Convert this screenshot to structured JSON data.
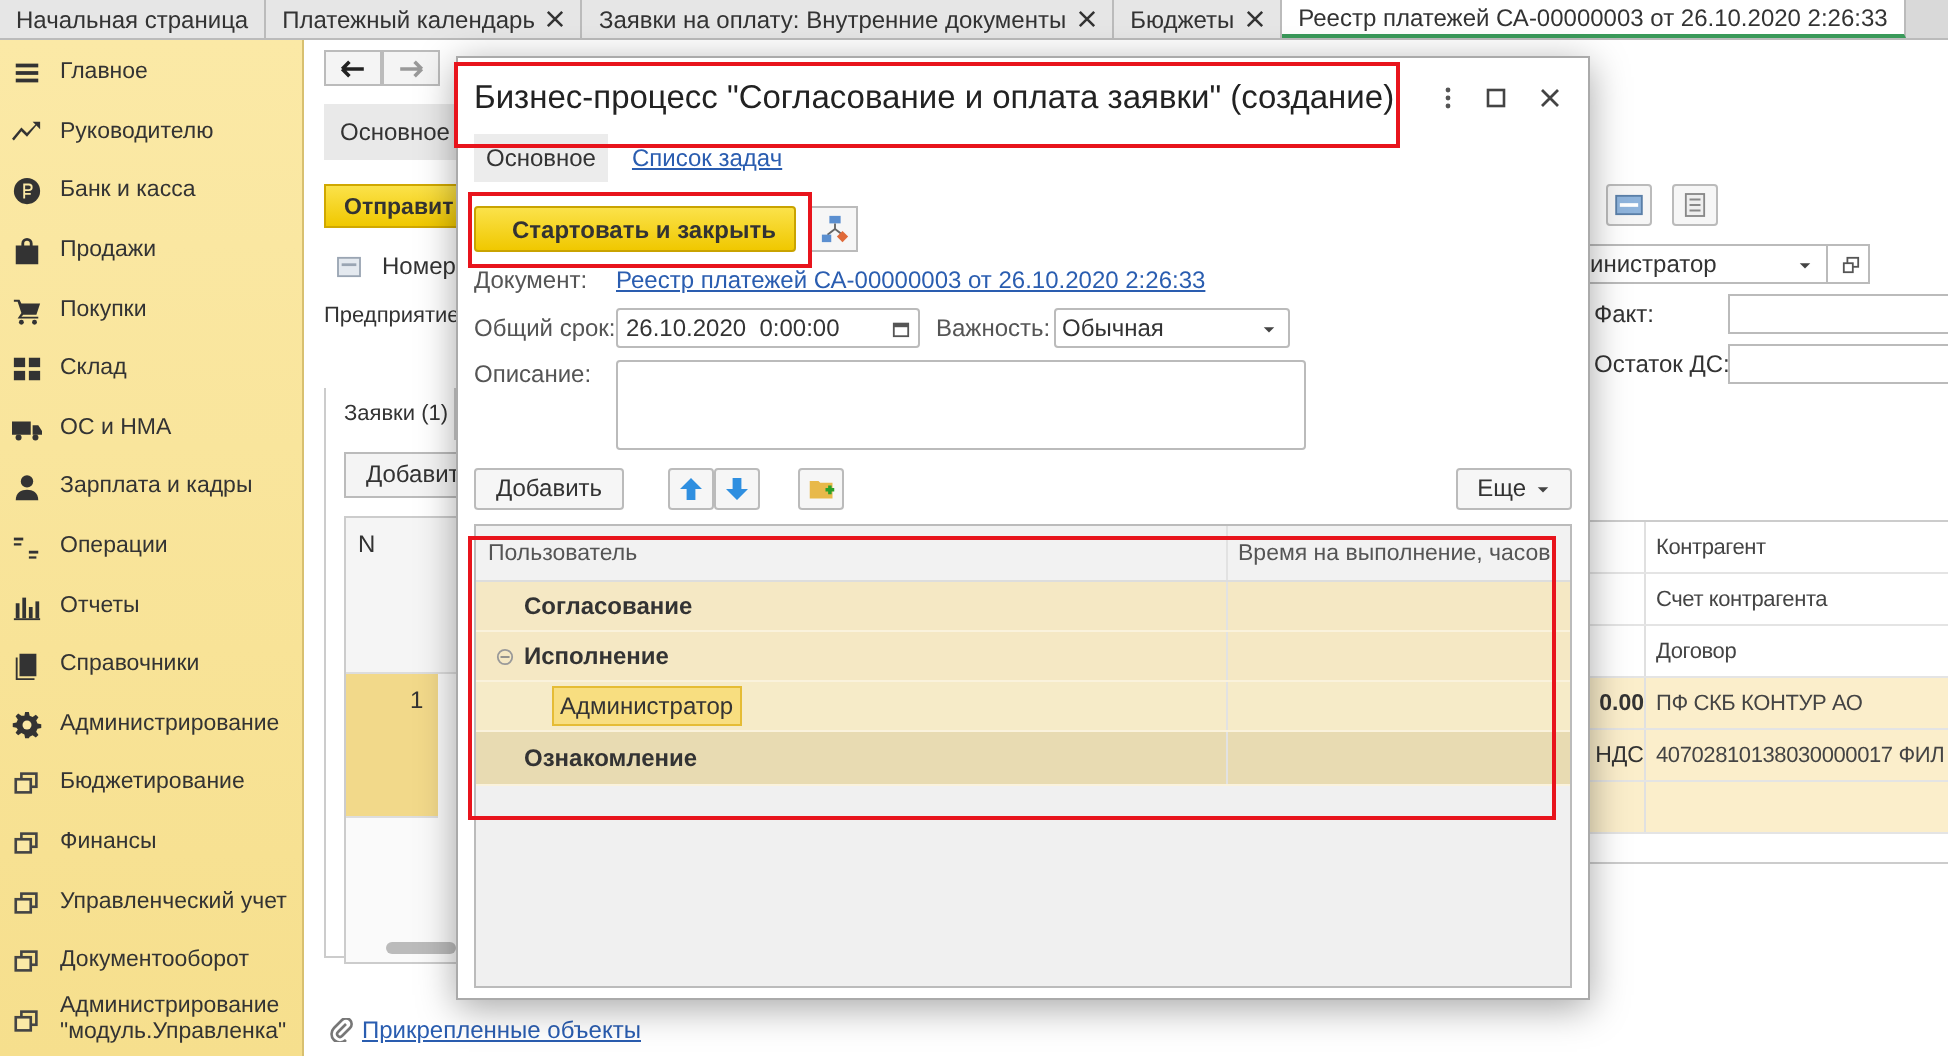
{
  "tabs": [
    {
      "label": "Начальная страница",
      "closable": false,
      "selected": false
    },
    {
      "label": "Платежный календарь",
      "closable": true,
      "selected": false
    },
    {
      "label": "Заявки на оплату: Внутренние документы",
      "closable": true,
      "selected": false
    },
    {
      "label": "Бюджеты",
      "closable": true,
      "selected": false
    },
    {
      "label": "Реестр платежей СА-00000003 от 26.10.2020 2:26:33",
      "closable": false,
      "selected": true
    }
  ],
  "sidebar": {
    "items": [
      {
        "label": "Главное"
      },
      {
        "label": "Руководителю"
      },
      {
        "label": "Банк и касса"
      },
      {
        "label": "Продажи"
      },
      {
        "label": "Покупки"
      },
      {
        "label": "Склад"
      },
      {
        "label": "ОС и НМА"
      },
      {
        "label": "Зарплата и кадры"
      },
      {
        "label": "Операции"
      },
      {
        "label": "Отчеты"
      },
      {
        "label": "Справочники"
      },
      {
        "label": "Администрирование"
      },
      {
        "label": "Бюджетирование"
      },
      {
        "label": "Финансы"
      },
      {
        "label": "Управленческий учет"
      },
      {
        "label": "Документооборот"
      },
      {
        "label": "Администрирование \"модуль.Управленка\""
      }
    ]
  },
  "document": {
    "tabs": [
      {
        "label": "Основное",
        "selected": true
      }
    ],
    "send_button": "Отправит",
    "number_label": "Номер",
    "org_label": "Предприятие",
    "section_tabs": [
      {
        "label": "Заявки (1)",
        "selected": true
      }
    ],
    "add_button": "Добавит",
    "table": {
      "columns": [
        "N"
      ],
      "rows": [
        {
          "n": "1",
          "selected": true
        }
      ]
    },
    "author_value": "инистратор",
    "fact_label": "Факт:",
    "balance_label": "Остаток ДС:",
    "right_table": {
      "columns": [
        "Контрагент",
        "Счет контрагента",
        "Договор"
      ],
      "rows": [
        {
          "amount": "0.00",
          "vat": "НДС",
          "counterparty": "ПФ СКБ КОНТУР АО",
          "account": "40702810138030000017 ФИЛ",
          "selected": true
        }
      ]
    },
    "attachments_link": "Прикрепленные объекты"
  },
  "dialog": {
    "title": "Бизнес-процесс \"Согласование и оплата заявки\" (создание)",
    "tabs": [
      {
        "label": "Основное",
        "selected": true
      },
      {
        "label": "Список задач",
        "selected": false
      }
    ],
    "start_button": "Стартовать и закрыть",
    "document_label": "Документ:",
    "document_link": "Реестр платежей СА-00000003 от 26.10.2020 2:26:33",
    "deadline_label": "Общий срок:",
    "deadline_value": "26.10.2020  0:00:00",
    "importance_label": "Важность:",
    "importance_value": "Обычная",
    "description_label": "Описание:",
    "add_button": "Добавить",
    "more_button": "Еще",
    "table": {
      "columns": [
        "Пользователь",
        "Время на выполнение, часов"
      ],
      "rows": [
        {
          "user": "Согласование",
          "expanded": false,
          "current": false
        },
        {
          "user": "Исполнение",
          "expanded": true,
          "current": false,
          "children": [
            {
              "user": "Администратор",
              "selected": true
            }
          ]
        },
        {
          "user": "Ознакомление",
          "expanded": false,
          "current": true
        }
      ]
    }
  }
}
